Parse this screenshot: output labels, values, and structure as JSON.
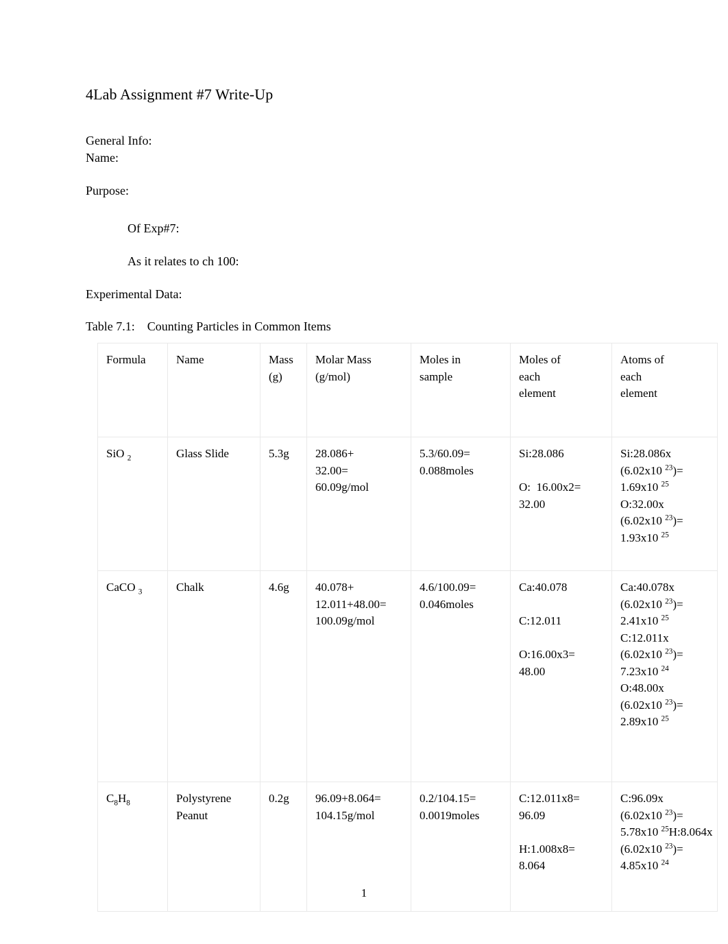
{
  "document": {
    "title": "4Lab Assignment #7 Write-Up",
    "page_number": "1",
    "sections": {
      "general_info_label": "General Info:",
      "name_label": "Name:",
      "purpose_label": "Purpose:",
      "of_exp_label": "Of Exp#7:",
      "relates_label": "As it relates to ch 100:",
      "experimental_data_label": "Experimental Data:",
      "table_caption": "Table 7.1:    Counting Particles in Common Items"
    }
  },
  "table": {
    "headers": [
      "Formula",
      "Name",
      "Mass\n(g)",
      "Molar Mass\n(g/mol)",
      "Moles in\nsample",
      "Moles of\neach\nelement",
      "Atoms of\neach\nelement"
    ],
    "rows": [
      {
        "formula_base": "SiO ",
        "formula_sub": "2",
        "name": "Glass Slide",
        "mass": "5.3g",
        "molar_mass": "28.086+\n32.00=\n60.09g/mol",
        "moles_in_sample": "5.3/60.09=\n0.088moles",
        "moles_each_element": "Si:28.086\n\nO:  16.00x2=\n32.00",
        "atoms_each_element": [
          {
            "pre": "Si:28.086x\n(6.02x10 ",
            "sup": "23",
            "mid": ")=\n1.69x10 ",
            "sup2": "25",
            "post": ""
          },
          {
            "pre": "\nO:32.00x\n(6.02x10 ",
            "sup": "23",
            "mid": ")=\n1.93x10 ",
            "sup2": "25",
            "post": ""
          }
        ]
      },
      {
        "formula_base": "CaCO ",
        "formula_sub": "3",
        "name": "Chalk",
        "mass": "4.6g",
        "molar_mass": "40.078+\n12.011+48.00=\n100.09g/mol",
        "moles_in_sample": "4.6/100.09=\n0.046moles",
        "moles_each_element": "Ca:40.078\n\nC:12.011\n\nO:16.00x3=\n48.00",
        "atoms_each_element": [
          {
            "pre": "Ca:40.078x\n(6.02x10 ",
            "sup": "23",
            "mid": ")=\n2.41x10 ",
            "sup2": "25",
            "post": ""
          },
          {
            "pre": "\nC:12.011x\n(6.02x10 ",
            "sup": "23",
            "mid": ")=\n7.23x10 ",
            "sup2": "24",
            "post": ""
          },
          {
            "pre": "\nO:48.00x\n(6.02x10 ",
            "sup": "23",
            "mid": ")=\n2.89x10 ",
            "sup2": "25",
            "post": ""
          }
        ]
      },
      {
        "formula_base": "C",
        "formula_sub": "8",
        "formula_base2": "H",
        "formula_sub2": "8",
        "name": "Polystyrene\nPeanut",
        "mass": "0.2g",
        "molar_mass": "96.09+8.064=\n104.15g/mol",
        "moles_in_sample": "0.2/104.15=\n0.0019moles",
        "moles_each_element": "C:12.011x8=\n96.09\n\nH:1.008x8=\n8.064",
        "atoms_each_element": [
          {
            "pre": "C:96.09x\n(6.02x10 ",
            "sup": "23",
            "mid": ")=\n5.78x10 ",
            "sup2": "25",
            "post": ""
          },
          {
            "pre": "H:8.064x\n(6.02x10 ",
            "sup": "23",
            "mid": ")=\n4.85x10 ",
            "sup2": "24",
            "post": ""
          }
        ]
      }
    ]
  }
}
